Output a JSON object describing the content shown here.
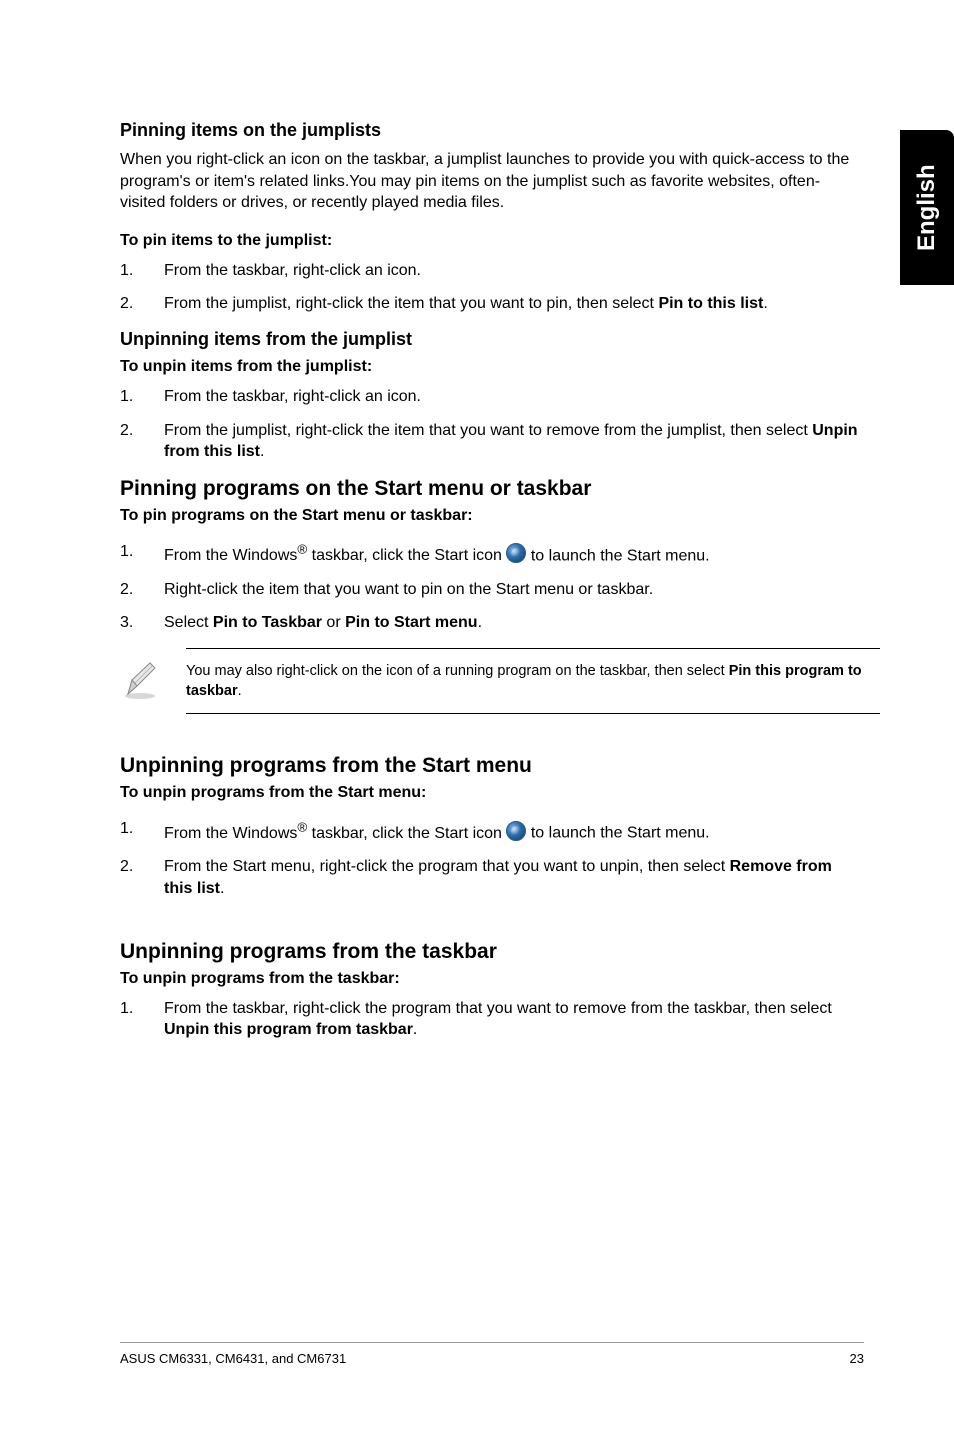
{
  "side_tab": "English",
  "sec1": {
    "heading": "Pinning items on the jumplists",
    "intro": "When you right-click an icon on the taskbar, a jumplist launches to provide you with quick-access to the program's or item's related links.You may pin items on the jumplist such as favorite websites, often-visited folders or drives, or recently played media files.",
    "steps_heading": "To pin items to the jumplist:",
    "steps": [
      "From the taskbar, right-click an icon.",
      "From the jumplist, right-click the item that you want to pin, then select <b>Pin to this list</b>."
    ]
  },
  "sec2": {
    "heading": "Unpinning items from the jumplist",
    "steps_heading": "To unpin items from the jumplist:",
    "steps": [
      "From the taskbar, right-click an icon.",
      "From the jumplist, right-click the item that you want to remove from the jumplist, then select <b>Unpin from this list</b>."
    ]
  },
  "sec3": {
    "heading": "Pinning programs on the Start menu or taskbar",
    "steps_heading": "To pin programs on the Start menu or taskbar:",
    "step1_pre": "From the Windows<sup>®</sup> taskbar, click the Start icon ",
    "step1_post": " to launch the Start menu.",
    "step2": "Right-click the item that you want to pin on the Start menu or taskbar.",
    "step3": "Select <b>Pin to Taskbar</b> or <b>Pin to Start menu</b>.",
    "note": "You may also right-click on the icon of a running program on the taskbar, then select <b>Pin this program to taskbar</b>."
  },
  "sec4": {
    "heading": "Unpinning programs from the Start menu",
    "steps_heading": "To unpin programs from the Start menu:",
    "step1_pre": "From the Windows<sup>®</sup> taskbar, click the Start icon ",
    "step1_post": " to launch the Start menu.",
    "step2": "From the Start menu, right-click the program that you want to unpin, then select <b>Remove from this list</b>."
  },
  "sec5": {
    "heading": "Unpinning programs from the taskbar",
    "steps_heading": "To unpin programs from the taskbar:",
    "step1": "From the taskbar, right-click the program that you want to remove from the taskbar, then select <b>Unpin this program from taskbar</b>."
  },
  "footer": {
    "left": "ASUS CM6331, CM6431, and CM6731",
    "right": "23"
  }
}
